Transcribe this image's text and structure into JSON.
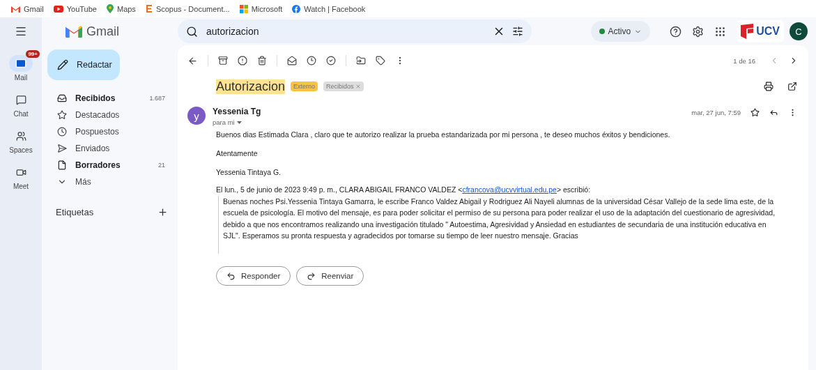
{
  "bookmarks": [
    {
      "kind": "gmail",
      "label": "Gmail"
    },
    {
      "kind": "youtube",
      "label": "YouTube"
    },
    {
      "kind": "maps",
      "label": "Maps"
    },
    {
      "kind": "scopus",
      "label": "Scopus - Document..."
    },
    {
      "kind": "microsoft",
      "label": "Microsoft"
    },
    {
      "kind": "facebook",
      "label": "Watch | Facebook"
    }
  ],
  "header": {
    "app_name": "Gmail",
    "search": {
      "value": "autorizacion"
    },
    "status": "Activo",
    "org_logo": "UCV",
    "avatar": "C"
  },
  "rail": [
    {
      "kind": "mail",
      "label": "Mail",
      "badge": "99+",
      "selected": true
    },
    {
      "kind": "chat",
      "label": "Chat",
      "selected": false
    },
    {
      "kind": "spaces",
      "label": "Spaces",
      "selected": false
    },
    {
      "kind": "meet",
      "label": "Meet",
      "selected": false
    }
  ],
  "compose": "Redactar",
  "folders": [
    {
      "kind": "inbox",
      "label": "Recibidos",
      "count": "1.687",
      "unread": true
    },
    {
      "kind": "starred",
      "label": "Destacados",
      "unread": false
    },
    {
      "kind": "snoozed",
      "label": "Pospuestos",
      "unread": false
    },
    {
      "kind": "sent",
      "label": "Enviados",
      "unread": false
    },
    {
      "kind": "drafts",
      "label": "Borradores",
      "count": "21",
      "unread": true
    },
    {
      "kind": "more",
      "label": "Más",
      "unread": false
    }
  ],
  "labels_heading": "Etiquetas",
  "pagination": "1 de 16",
  "thread": {
    "subject": "Autorizacion",
    "highlighted": true,
    "labels": [
      {
        "text": "Externo",
        "color": "#f6c342",
        "removable": false
      },
      {
        "text": "Recibidos",
        "color": "#dddddd",
        "removable": true
      }
    ],
    "message": {
      "sender": "Yessenia Tg",
      "avatar": "y",
      "recipient": "para mi",
      "date": "mar, 27 jun, 7:59",
      "paragraphs": [
        "Buenos dias Estimada Clara , claro que te autorizo realizar la prueba estandarizada por  mi persona , te deseo muchos éxitos y bendiciones.",
        "Atentamente",
        "Yessenia Tintaya G."
      ],
      "quote_intro": "El lun., 5 de junio de 2023 9:49 p. m., CLARA ABIGAIL FRANCO VALDEZ <",
      "quote_email": "cfrancova@ucvvirtual.edu.pe",
      "quote_outro": "> escribió:",
      "quote": "Buenas noches Psi.Yessenia Tintaya Gamarra, le escribe Franco Valdez Abigail y Rodriguez Ali Nayeli alumnas de la universidad César Vallejo de la sede lima este, de la escuela de psicología. El motivo del mensaje, es para poder solicitar el permiso de su persona para poder realizar el uso de la adaptación del cuestionario de agresividad, debido a que nos encontramos realizando una investigación titulado \" Autoestima, Agresividad y Ansiedad en estudiantes de secundaria de una institución educativa en SJL\". Esperamos su pronta respuesta y agradecidos por tomarse su tiempo de leer nuestro mensaje. Gracias"
    },
    "actions": [
      {
        "kind": "reply",
        "label": "Responder"
      },
      {
        "kind": "forward",
        "label": "Reenviar"
      }
    ]
  }
}
